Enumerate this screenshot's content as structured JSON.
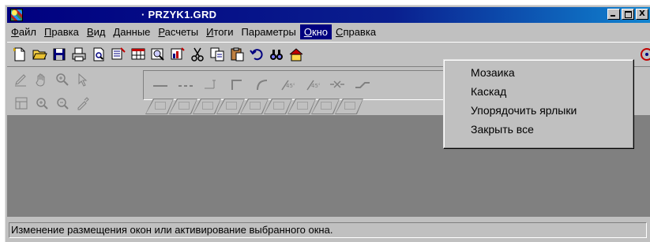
{
  "window": {
    "title": "· PRZYK1.GRD",
    "buttons": {
      "minimize": "_",
      "maximize": "□",
      "close": "X"
    }
  },
  "menubar": {
    "items": [
      {
        "label": "Файл",
        "underline": "Ф",
        "rest": "айл"
      },
      {
        "label": "Правка",
        "underline": "П",
        "rest": "равка"
      },
      {
        "label": "Вид",
        "underline": "В",
        "rest": "ид"
      },
      {
        "label": "Данные",
        "underline": "Д",
        "rest": "анные"
      },
      {
        "label": "Расчеты",
        "underline": "Р",
        "rest": "асчеты"
      },
      {
        "label": "Итоги",
        "underline": "И",
        "rest": "тоги"
      },
      {
        "label": "Параметры",
        "underline": "",
        "rest": "Параметры"
      },
      {
        "label": "Окно",
        "underline": "О",
        "rest": "кно",
        "active": true
      },
      {
        "label": "Справка",
        "underline": "С",
        "rest": "правка"
      }
    ]
  },
  "window_menu": {
    "items": [
      "Мозаика",
      "Каскад",
      "Упорядочить ярлыки",
      "Закрыть все"
    ]
  },
  "toolbar_icons": [
    "new-file-icon",
    "open-folder-icon",
    "save-icon",
    "print-icon",
    "print-preview-icon",
    "edit-data-icon",
    "table-icon",
    "zoom-preview-icon",
    "chart-icon",
    "cut-icon",
    "copy-icon",
    "paste-icon",
    "undo-icon",
    "find-icon",
    "home-icon"
  ],
  "statusbar": {
    "text": "Изменение размещения окон или активирование выбранного окна."
  },
  "colors": {
    "titlebar": "#000080",
    "face": "#c0c0c0",
    "client": "#808080",
    "highlight": "#000080"
  }
}
